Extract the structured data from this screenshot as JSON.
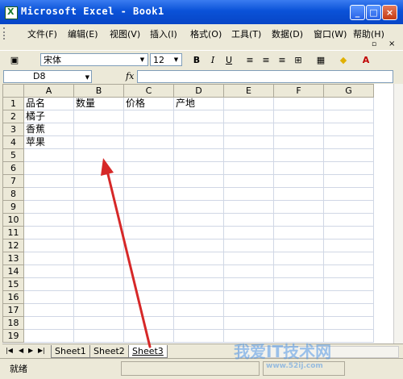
{
  "window": {
    "title": "Microsoft Excel - Book1",
    "min": "_",
    "max": "□",
    "close": "×"
  },
  "menu": [
    "文件(F)",
    "编辑(E)",
    "视图(V)",
    "插入(I)",
    "格式(O)",
    "工具(T)",
    "数据(D)",
    "窗口(W)",
    "帮助(H)"
  ],
  "toolbar": {
    "font": "宋体",
    "size": "12",
    "bold": "B",
    "italic": "I",
    "underline": "U"
  },
  "formula": {
    "namebox": "D8",
    "fx": "fx",
    "value": ""
  },
  "columns": [
    "A",
    "B",
    "C",
    "D",
    "E",
    "F",
    "G"
  ],
  "rows": [
    [
      "品名",
      "数量",
      "价格",
      "产地",
      "",
      "",
      ""
    ],
    [
      "橘子",
      "",
      "",
      "",
      "",
      "",
      ""
    ],
    [
      "香蕉",
      "",
      "",
      "",
      "",
      "",
      ""
    ],
    [
      "苹果",
      "",
      "",
      "",
      "",
      "",
      ""
    ],
    [
      "",
      "",
      "",
      "",
      "",
      "",
      ""
    ],
    [
      "",
      "",
      "",
      "",
      "",
      "",
      ""
    ],
    [
      "",
      "",
      "",
      "",
      "",
      "",
      ""
    ],
    [
      "",
      "",
      "",
      "",
      "",
      "",
      ""
    ],
    [
      "",
      "",
      "",
      "",
      "",
      "",
      ""
    ],
    [
      "",
      "",
      "",
      "",
      "",
      "",
      ""
    ],
    [
      "",
      "",
      "",
      "",
      "",
      "",
      ""
    ],
    [
      "",
      "",
      "",
      "",
      "",
      "",
      ""
    ],
    [
      "",
      "",
      "",
      "",
      "",
      "",
      ""
    ],
    [
      "",
      "",
      "",
      "",
      "",
      "",
      ""
    ],
    [
      "",
      "",
      "",
      "",
      "",
      "",
      ""
    ],
    [
      "",
      "",
      "",
      "",
      "",
      "",
      ""
    ],
    [
      "",
      "",
      "",
      "",
      "",
      "",
      ""
    ],
    [
      "",
      "",
      "",
      "",
      "",
      "",
      ""
    ],
    [
      "",
      "",
      "",
      "",
      "",
      "",
      ""
    ]
  ],
  "sheets": [
    "Sheet1",
    "Sheet2",
    "Sheet3"
  ],
  "active_sheet": "Sheet3",
  "status": "就绪",
  "watermark": "我爱IT技术网",
  "watermark_url": "www.52ij.com"
}
